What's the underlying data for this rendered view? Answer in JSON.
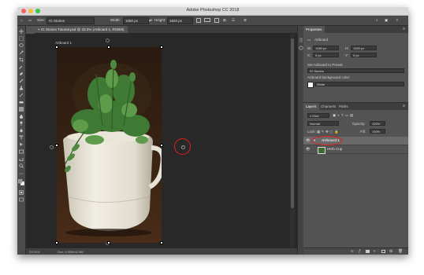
{
  "app": {
    "title": "Adobe Photoshop CC 2018"
  },
  "options_bar": {
    "size_label": "Size:",
    "size_value": "IG Stories",
    "width_label": "Width:",
    "width_value": "1080 px",
    "height_label": "Height:",
    "height_value": "1920 px"
  },
  "document": {
    "tab_label": "IG Stories Tutorial.psd @ 33.3% (Artboard 1, RGB/8)"
  },
  "artboard": {
    "label": "Artboard 1"
  },
  "status": {
    "zoom": "33.33%",
    "doc_info": "Doc: 5.93M/42.5M"
  },
  "properties": {
    "tab_label": "Properties",
    "type_label": "Artboard",
    "w_label": "W:",
    "w_value": "1080 px",
    "h_label": "H:",
    "h_value": "1920 px",
    "x_label": "X:",
    "x_value": "0 px",
    "y_label": "Y:",
    "y_value": "0 px",
    "preset_label": "Set Artboard to Preset:",
    "preset_value": "IG Stories",
    "bg_label": "Artboard background color:",
    "bg_value": "White"
  },
  "layers_panel": {
    "tabs": [
      "Layers",
      "Channels",
      "Paths"
    ],
    "kind_label": "Kind",
    "blend_mode": "Normal",
    "opacity_label": "Opacity:",
    "opacity_value": "100%",
    "lock_label": "Lock:",
    "fill_label": "Fill:",
    "fill_value": "100%",
    "layers": [
      {
        "name": "Artboard 1"
      },
      {
        "name": "Herb Cup"
      }
    ]
  },
  "colors": {
    "highlight_circle": "#e02020"
  }
}
